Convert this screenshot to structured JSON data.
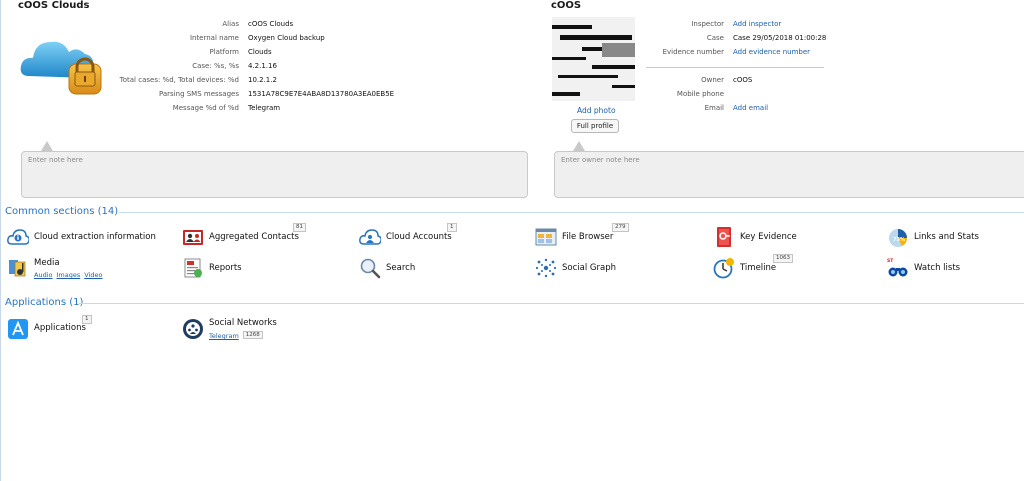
{
  "left_panel": {
    "title": "cOOS Clouds",
    "properties": [
      {
        "label": "Alias",
        "value": "cOOS Clouds"
      },
      {
        "label": "Internal name",
        "value": "Oxygen Cloud backup"
      },
      {
        "label": "Platform",
        "value": "Clouds"
      },
      {
        "label": "Case: %s, %s",
        "value": "4.2.1.16"
      },
      {
        "label": "Total cases: %d, Total devices: %d",
        "value": "10.2.1.2"
      },
      {
        "label": "Parsing SMS messages",
        "value": "1531A78C9E7E4ABA8D13780A3EA0EB5E"
      },
      {
        "label": "Message %d of %d",
        "value": "Telegram"
      }
    ],
    "note_placeholder": "Enter note here"
  },
  "right_panel": {
    "title": "cOOS",
    "add_photo": "Add photo",
    "full_profile": "Full profile",
    "properties": [
      {
        "label": "Inspector",
        "value": "Add inspector",
        "link": true
      },
      {
        "label": "Case",
        "value": "Case 29/05/2018 01:00:28",
        "link": false
      },
      {
        "label": "Evidence number",
        "value": "Add evidence number",
        "link": true
      },
      {
        "label": "Owner",
        "value": "cOOS",
        "link": false
      },
      {
        "label": "Mobile phone",
        "value": "",
        "link": false
      },
      {
        "label": "Email",
        "value": "Add email",
        "link": true
      }
    ],
    "note_placeholder": "Enter owner note here"
  },
  "common": {
    "title": "Common sections (14)",
    "items": [
      {
        "label": "Cloud extraction information",
        "badge": "",
        "icon": "cloud-info-icon"
      },
      {
        "label": "Aggregated Contacts",
        "badge": "81",
        "icon": "contacts-icon"
      },
      {
        "label": "Cloud Accounts",
        "badge": "1",
        "icon": "cloud-accounts-icon"
      },
      {
        "label": "File Browser",
        "badge": "279",
        "icon": "file-browser-icon"
      },
      {
        "label": "Key Evidence",
        "badge": "",
        "icon": "key-evidence-icon"
      },
      {
        "label": "Links and Stats",
        "badge": "",
        "icon": "links-stats-icon"
      },
      {
        "label": "Media",
        "badge": "",
        "icon": "media-icon",
        "subs": [
          "Audio",
          "Images",
          "Video"
        ]
      },
      {
        "label": "Reports",
        "badge": "",
        "icon": "reports-icon"
      },
      {
        "label": "Search",
        "badge": "",
        "icon": "search-icon"
      },
      {
        "label": "Social Graph",
        "badge": "",
        "icon": "social-graph-icon"
      },
      {
        "label": "Timeline",
        "badge": "1063",
        "icon": "timeline-icon"
      },
      {
        "label": "Watch lists",
        "badge": "",
        "icon": "watch-lists-icon"
      }
    ]
  },
  "applications": {
    "title": "Applications (1)",
    "items": [
      {
        "label": "Applications",
        "badge": "1",
        "icon": "applications-icon"
      },
      {
        "label": "Social Networks",
        "badge": "",
        "icon": "social-networks-icon",
        "sub": "Telegram",
        "sub_badge": "1268"
      }
    ]
  }
}
